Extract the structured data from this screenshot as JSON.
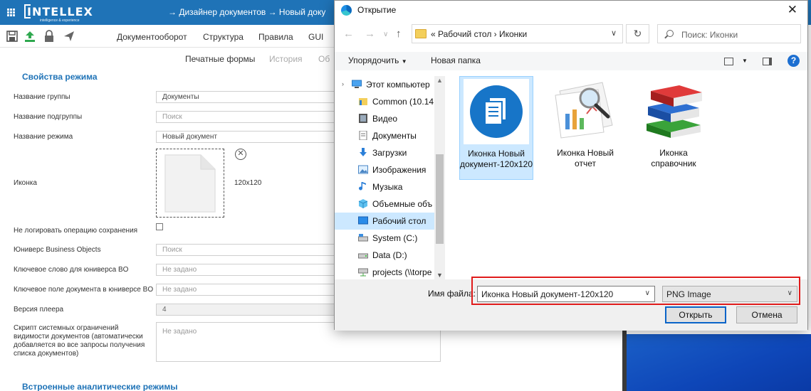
{
  "app": {
    "logo_text": "INTELLEX",
    "logo_tagline": "intelligence & experience",
    "breadcrumb": "→ Дизайнер документов → Новый доку"
  },
  "menu": {
    "items": [
      "Документооборот",
      "Структура",
      "Правила",
      "GUI"
    ],
    "subtabs": [
      "Печатные формы",
      "История",
      "Об"
    ]
  },
  "form": {
    "section_title": "Свойства режима",
    "fields": [
      {
        "label": "Название группы",
        "value": "Документы",
        "placeholder": ""
      },
      {
        "label": "Название подгруппы",
        "value": "",
        "placeholder": "Поиск"
      },
      {
        "label": "Название режима",
        "value": "Новый документ",
        "placeholder": ""
      }
    ],
    "icon_label": "Иконка",
    "icon_size": "120x120",
    "nolog_label": "Не логировать операцию сохранения",
    "fields2": [
      {
        "label": "Юниверс Business Objects",
        "value": "",
        "placeholder": "Поиск"
      },
      {
        "label": "Ключевое слово для юниверса BO",
        "value": "",
        "placeholder": "Не задано"
      },
      {
        "label": "Ключевое поле документа в юниверсе BO",
        "value": "",
        "placeholder": "Не задано"
      }
    ],
    "player_version_label": "Версия плеера",
    "player_version_value": "4",
    "script_label": "Скрипт системных ограничений видимости документов (автоматически добавляется во все запросы получения списка документов)",
    "script_placeholder": "Не задано",
    "section2_title": "Встроенные аналитические режимы"
  },
  "dialog": {
    "title": "Открытие",
    "address": "« Рабочий стол › Иконки",
    "search_placeholder": "Поиск: Иконки",
    "organize_label": "Упорядочить",
    "new_folder_label": "Новая папка",
    "tree": [
      {
        "label": "Этот компьютер",
        "icon": "computer-icon"
      },
      {
        "label": "Common (10.14",
        "icon": "network-folder-icon"
      },
      {
        "label": "Видео",
        "icon": "video-icon"
      },
      {
        "label": "Документы",
        "icon": "documents-icon"
      },
      {
        "label": "Загрузки",
        "icon": "download-icon"
      },
      {
        "label": "Изображения",
        "icon": "pictures-icon"
      },
      {
        "label": "Музыка",
        "icon": "music-icon"
      },
      {
        "label": "Объемные объ",
        "icon": "3d-objects-icon"
      },
      {
        "label": "Рабочий стол",
        "icon": "desktop-icon"
      },
      {
        "label": "System (C:)",
        "icon": "drive-icon"
      },
      {
        "label": "Data (D:)",
        "icon": "drive-icon"
      },
      {
        "label": "projects (\\\\torpe",
        "icon": "network-drive-icon"
      }
    ],
    "files": [
      {
        "label": "Иконка Новый документ-120x120",
        "icon": "document-icon",
        "selected": true
      },
      {
        "label": "Иконка Новый отчет",
        "icon": "report-icon",
        "selected": false
      },
      {
        "label": "Иконка справочник",
        "icon": "books-icon",
        "selected": false
      }
    ],
    "filename_label": "Имя файла:",
    "filename_value": "Иконка Новый документ-120x120",
    "filetype_value": "PNG Image",
    "open_label": "Открыть",
    "cancel_label": "Отмена"
  }
}
